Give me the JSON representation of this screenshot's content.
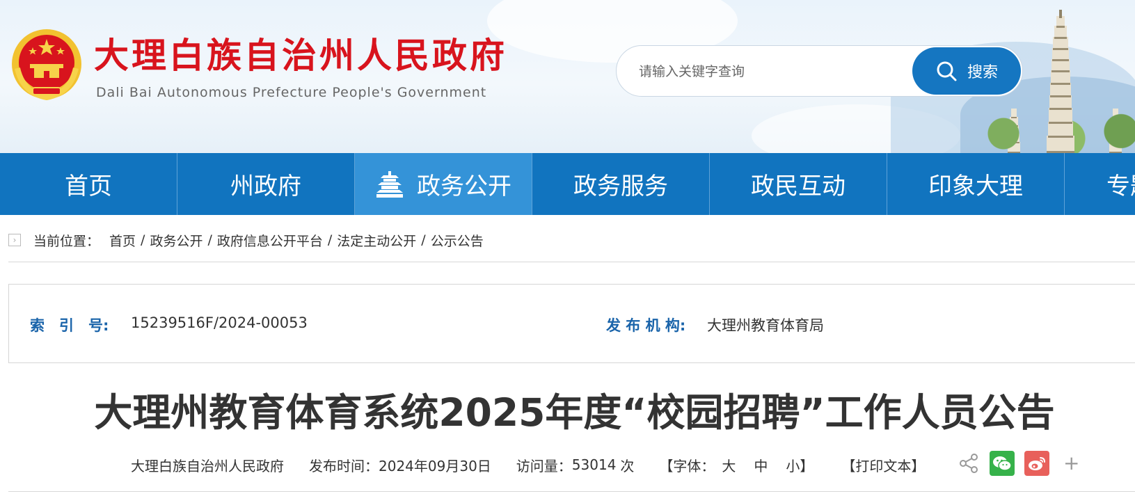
{
  "header": {
    "title": "大理白族自治州人民政府",
    "subtitle": "Dali Bai Autonomous Prefecture People's Government",
    "emblem": "national-emblem",
    "colors": {
      "title": "#d8141d",
      "brand_blue": "#1174bf"
    }
  },
  "search": {
    "placeholder": "请输入关键字查询",
    "button_label": "搜索",
    "icon": "search-icon"
  },
  "nav": {
    "items": [
      {
        "label": "首页"
      },
      {
        "label": "州政府"
      },
      {
        "label": "政务公开",
        "active": true,
        "icon": "temple-icon"
      },
      {
        "label": "政务服务"
      },
      {
        "label": "政民互动"
      },
      {
        "label": "印象大理"
      },
      {
        "label": "专题"
      }
    ]
  },
  "breadcrumb": {
    "label": "当前位置：",
    "items": [
      "首页",
      "政务公开",
      "政府信息公开平台",
      "法定主动公开",
      "公示公告"
    ],
    "separator": "/"
  },
  "info": {
    "index_key": "索　引　号:",
    "index_value": "15239516F/2024-00053",
    "publisher_key": "发 布 机 构:",
    "publisher_value": "大理州教育体育局"
  },
  "article": {
    "title": "大理州教育体育系统2025年度“校园招聘”工作人员公告",
    "source": "大理白族自治州人民政府",
    "publish_label": "发布时间：",
    "publish_date": "2024年09月30日",
    "views_label": "访问量：",
    "views": "53014",
    "views_unit": "次",
    "font_prefix": "【字体：",
    "font_large": "大",
    "font_medium": "中",
    "font_small": "小",
    "font_suffix": "】",
    "print_label": "【打印文本】",
    "share_icons": [
      "share-icon",
      "wechat-icon",
      "weibo-icon",
      "plus-icon"
    ],
    "plus_glyph": "+"
  }
}
